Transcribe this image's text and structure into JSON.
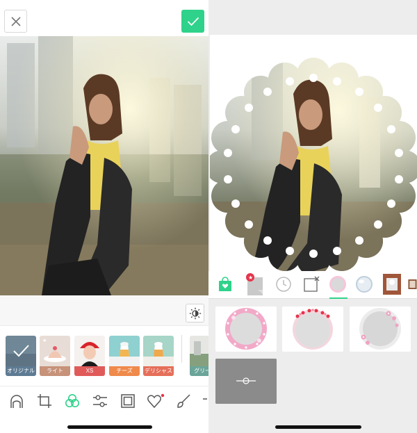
{
  "left_panel": {
    "filters": [
      {
        "label": "オリジナル",
        "color": "#5e7b93"
      },
      {
        "label": "ライト",
        "color": "#c69279"
      },
      {
        "label": "XS",
        "color": "#e05a5a"
      },
      {
        "label": "チーズ",
        "color": "#ef8a4b"
      },
      {
        "label": "デリシャス",
        "color": "#e56f59"
      },
      {
        "label": "グリーン",
        "color": "#6ba59a"
      }
    ],
    "tools": [
      "face-icon",
      "crop-icon",
      "filter-icon",
      "adjust-sliders-icon",
      "frame-icon",
      "sticker-heart-icon",
      "brush-icon"
    ],
    "accent": "#2fd28a"
  },
  "right_panel": {
    "frame_categories": [
      "shop-bag-icon",
      "new-frames-icon",
      "recent-clock-icon",
      "no-frame-icon",
      "frame-round-pink",
      "frame-glass-ball",
      "frame-photo-card",
      "frame-wood-card"
    ],
    "frames": [
      {
        "name": "frame-pink-dots"
      },
      {
        "name": "frame-red-hearts"
      },
      {
        "name": "frame-pink-flowers"
      },
      {
        "name": "frame-gray-adjust"
      }
    ]
  }
}
